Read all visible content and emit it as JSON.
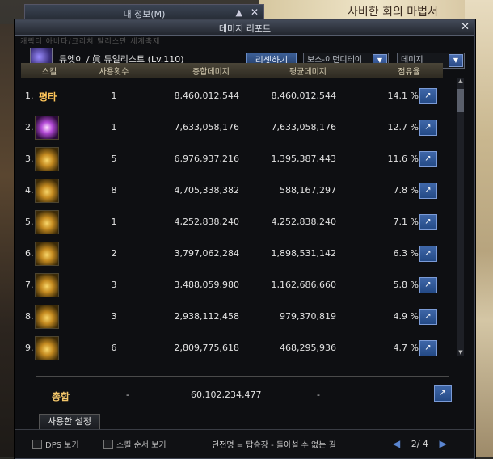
{
  "background": {
    "banner_text": "사비한 회의 마법서"
  },
  "behind_window": {
    "title": "내 정보(M)"
  },
  "window": {
    "title": "데미지 리포트",
    "tabs_behind": "캐릭터  아바타/크리쳐  탈리스만  세계축제"
  },
  "character": {
    "name": "듀엣이 / 眞 듀얼리스트 (Lv.110)"
  },
  "controls": {
    "reset_label": "리셋하기",
    "target_select": "보스-이던디테이",
    "mode_select": "데미지"
  },
  "table": {
    "headers": [
      "스킬",
      "사용횟수",
      "총합데미지",
      "평균데미지",
      "점유율"
    ],
    "rows": [
      {
        "num": "1.",
        "skill": "평타",
        "count": "1",
        "total": "8,460,012,544",
        "avg": "8,460,012,544",
        "pct": "14.1 %"
      },
      {
        "num": "2.",
        "skill": "",
        "count": "1",
        "total": "7,633,058,176",
        "avg": "7,633,058,176",
        "pct": "12.7 %"
      },
      {
        "num": "3.",
        "skill": "",
        "count": "5",
        "total": "6,976,937,216",
        "avg": "1,395,387,443",
        "pct": "11.6 %"
      },
      {
        "num": "4.",
        "skill": "",
        "count": "8",
        "total": "4,705,338,382",
        "avg": "588,167,297",
        "pct": "7.8 %"
      },
      {
        "num": "5.",
        "skill": "",
        "count": "1",
        "total": "4,252,838,240",
        "avg": "4,252,838,240",
        "pct": "7.1 %"
      },
      {
        "num": "6.",
        "skill": "",
        "count": "2",
        "total": "3,797,062,284",
        "avg": "1,898,531,142",
        "pct": "6.3 %"
      },
      {
        "num": "7.",
        "skill": "",
        "count": "3",
        "total": "3,488,059,980",
        "avg": "1,162,686,660",
        "pct": "5.8 %"
      },
      {
        "num": "8.",
        "skill": "",
        "count": "3",
        "total": "2,938,112,458",
        "avg": "979,370,819",
        "pct": "4.9 %"
      },
      {
        "num": "9.",
        "skill": "",
        "count": "6",
        "total": "2,809,775,618",
        "avg": "468,295,936",
        "pct": "4.7 %"
      }
    ]
  },
  "total": {
    "label": "총합",
    "count": "-",
    "total": "60,102,234,477",
    "avg": "-"
  },
  "footer": {
    "used_setting": "사용한 설정",
    "dps_label": "DPS 보기",
    "order_label": "스킬 순서 보기",
    "dungeon_text": "던전명 = 탑승장 - 돌아설 수 없는 길",
    "page": "2/ 4",
    "prev_arrow": "◀",
    "next_arrow": "▶"
  },
  "icons": {
    "close": "✕",
    "pin": "📌",
    "share": "↗",
    "dropdown": "▼"
  }
}
